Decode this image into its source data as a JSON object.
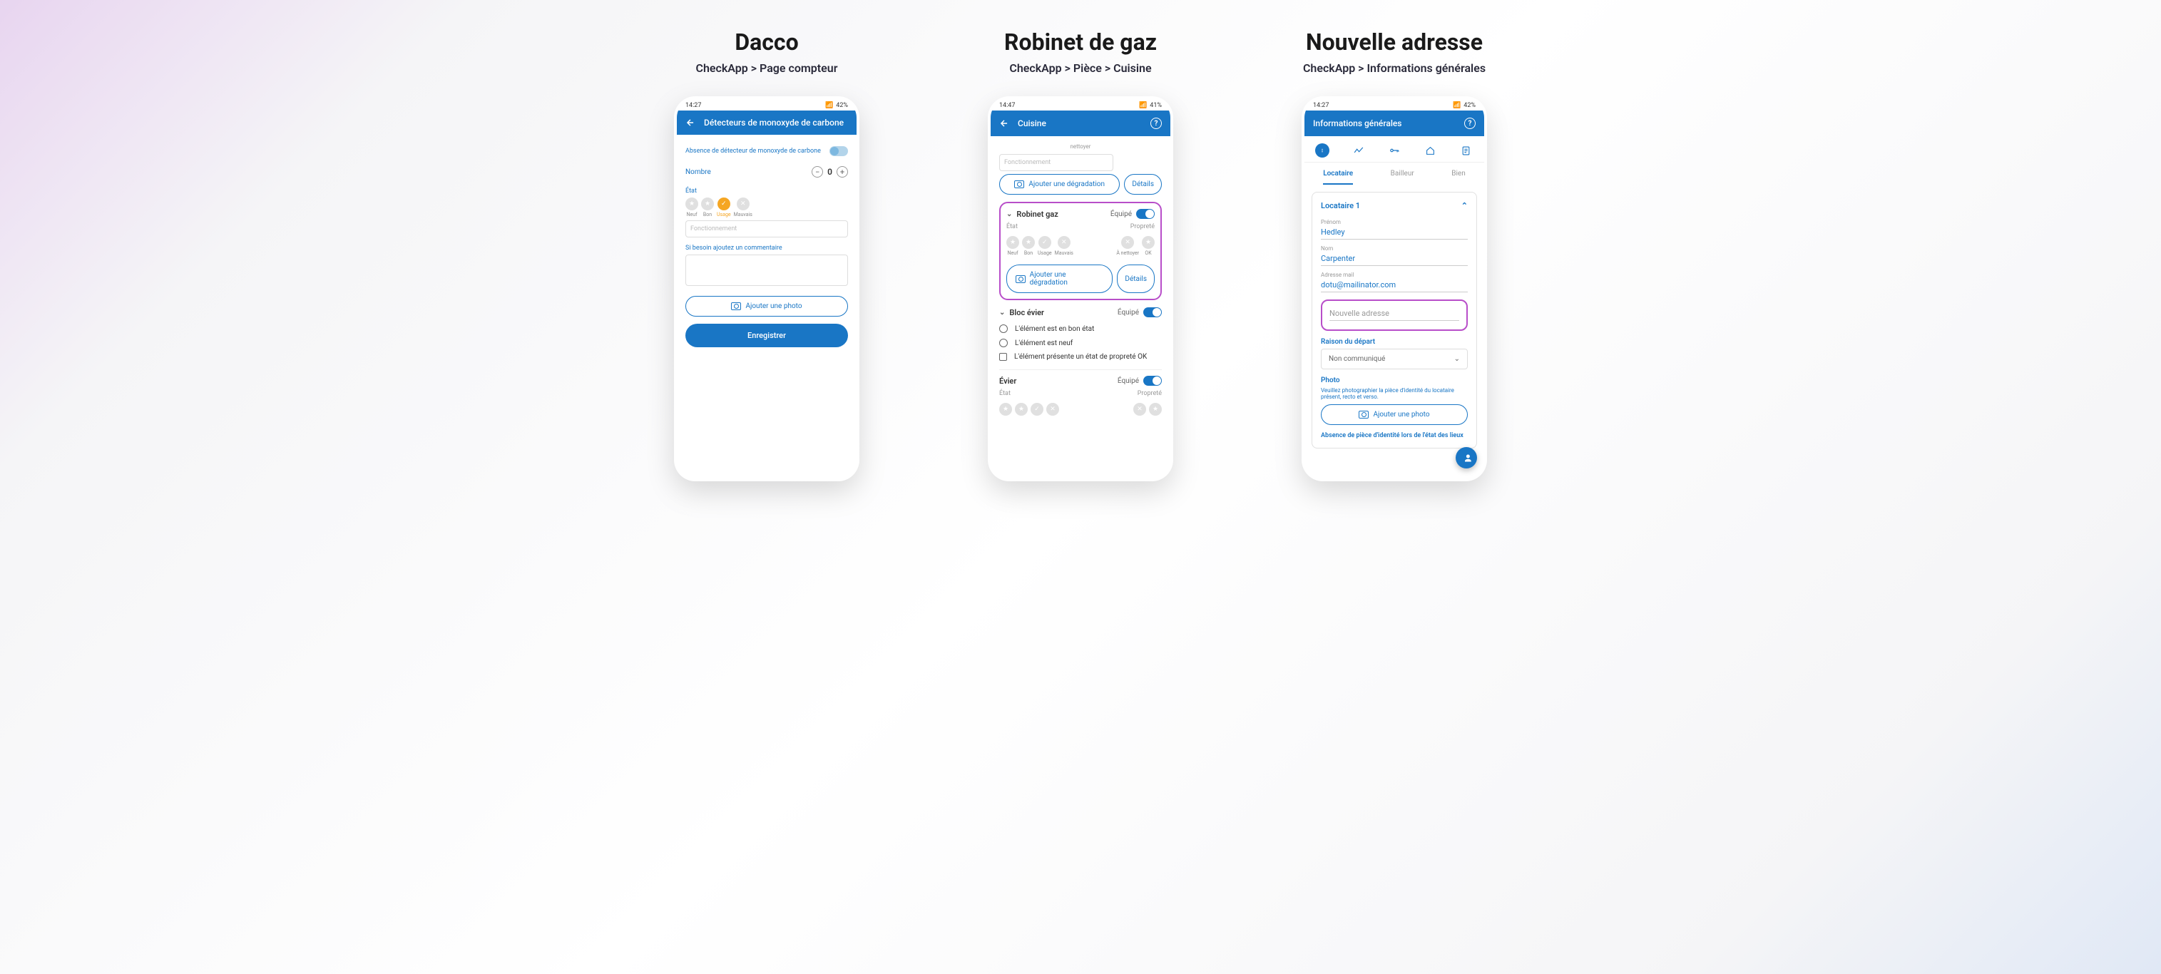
{
  "sections": {
    "s1": {
      "title": "Dacco",
      "breadcrumb": "CheckApp > Page compteur"
    },
    "s2": {
      "title": "Robinet de gaz",
      "breadcrumb": "CheckApp > Pièce > Cuisine"
    },
    "s3": {
      "title": "Nouvelle adresse",
      "breadcrumb": "CheckApp > Informations générales"
    }
  },
  "phone1": {
    "status_time": "14:27",
    "status_battery": "42%",
    "header_title": "Détecteurs de monoxyde de carbone",
    "absence_label": "Absence de détecteur de monoxyde de carbone",
    "nombre_label": "Nombre",
    "nombre_value": "0",
    "etat_label": "État",
    "states": {
      "neuf": "Neuf",
      "bon": "Bon",
      "usage": "Usage",
      "mauvais": "Mauvais"
    },
    "fonctionnement_placeholder": "Fonctionnement",
    "comment_label": "Si besoin ajoutez un commentaire",
    "add_photo_label": "Ajouter une photo",
    "save_label": "Enregistrer"
  },
  "phone2": {
    "status_time": "14:47",
    "status_battery": "41%",
    "header_title": "Cuisine",
    "partial_label": "nettoyer",
    "fonctionnement_placeholder": "Fonctionnement",
    "add_degradation_label": "Ajouter une dégradation",
    "details_label": "Détails",
    "robinet": {
      "title": "Robinet gaz",
      "equipe_label": "Équipé",
      "etat_label": "État",
      "proprete_label": "Propreté",
      "states": {
        "neuf": "Neuf",
        "bon": "Bon",
        "usage": "Usage",
        "mauvais": "Mauvais",
        "a_nettoyer": "À nettoyer",
        "ok": "OK"
      }
    },
    "bloc_evier": {
      "title": "Bloc évier",
      "equipe_label": "Équipé",
      "check1": "L'élément est en bon état",
      "check2": "L'élément est neuf",
      "check3": "L'élément présente un état de propreté OK"
    },
    "evier": {
      "title": "Évier",
      "equipe_label": "Équipé",
      "etat_label": "État",
      "proprete_label": "Propreté"
    }
  },
  "phone3": {
    "status_time": "14:27",
    "status_battery": "42%",
    "header_title": "Informations générales",
    "tabs": {
      "locataire": "Locataire",
      "bailleur": "Bailleur",
      "bien": "Bien"
    },
    "card_title": "Locataire 1",
    "prenom_label": "Prénom",
    "prenom_value": "Hedley",
    "nom_label": "Nom",
    "nom_value": "Carpenter",
    "email_label": "Adresse mail",
    "email_value": "dotu@mailinator.com",
    "nouvelle_adresse_placeholder": "Nouvelle adresse",
    "raison_label": "Raison du départ",
    "raison_value": "Non communiqué",
    "photo_label": "Photo",
    "photo_help": "Veuillez photographier la pièce d'identité du locataire présent, recto et verso.",
    "add_photo_label": "Ajouter une photo",
    "absence_label": "Absence de pièce d'identité lors de l'état des lieux"
  }
}
